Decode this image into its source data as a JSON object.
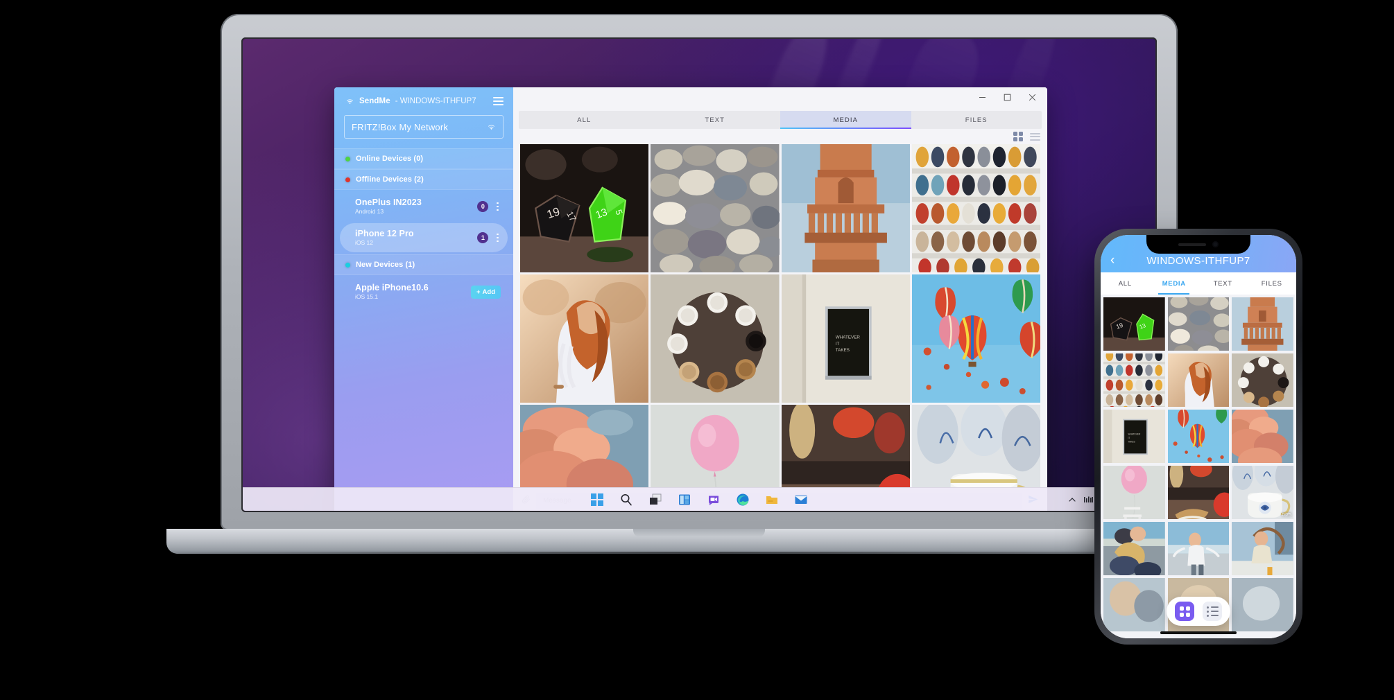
{
  "app": {
    "sidebar": {
      "brand": "SendMe",
      "separator": " - ",
      "hostname": "WINDOWS-ITHFUP7",
      "wifi_icon": "wifi-icon",
      "menu_icon": "hamburger-menu-icon",
      "network_name": "FRITZ!Box My Network",
      "network_icon": "wifi-icon",
      "groups": [
        {
          "label": "Online Devices (0)",
          "status": "online",
          "color": "#4fd441"
        },
        {
          "label": "Offline Devices (2)",
          "status": "offline",
          "color": "#e0342b"
        },
        {
          "label": "New Devices (1)",
          "status": "new",
          "color": "#19cfe0"
        }
      ],
      "offline_devices": [
        {
          "name": "OnePlus IN2023",
          "os": "Android 13",
          "badge": "0",
          "selected": false
        },
        {
          "name": "iPhone 12 Pro",
          "os": "iOS 12",
          "badge": "1",
          "selected": true
        }
      ],
      "new_devices": [
        {
          "name": "Apple iPhone10.6",
          "os": "iOS 15.1",
          "add_label": "Add",
          "add_icon": "plus-icon"
        }
      ]
    },
    "window_controls": {
      "minimize": "minimize-icon",
      "maximize": "maximize-icon",
      "close": "close-icon"
    },
    "tabs": [
      {
        "label": "ALL",
        "active": false
      },
      {
        "label": "TEXT",
        "active": false
      },
      {
        "label": "MEDIA",
        "active": true
      },
      {
        "label": "FILES",
        "active": false
      }
    ],
    "view_toggle": {
      "grid": "grid-view-icon",
      "list": "list-view-icon",
      "active": "grid"
    },
    "composer": {
      "attach_icon": "paperclip-icon",
      "placeholder": "Message",
      "value": "",
      "send_icon": "send-icon"
    },
    "gallery": [
      {
        "id": "dice",
        "alt": "two polyhedral dice black and green"
      },
      {
        "id": "pebbles",
        "alt": "smooth grey pebbles"
      },
      {
        "id": "tower",
        "alt": "red sandstone minaret tower"
      },
      {
        "id": "shoes",
        "alt": "colorful shoes on shelves"
      },
      {
        "id": "woman",
        "alt": "woman with red hair at sunset"
      },
      {
        "id": "coffee",
        "alt": "coffee cups arranged in circle on wood"
      },
      {
        "id": "poster",
        "alt": "framed black poster on wall"
      },
      {
        "id": "balloons",
        "alt": "hot air balloons in blue sky"
      },
      {
        "id": "clouds",
        "alt": "orange pink smoke clouds"
      },
      {
        "id": "balloon",
        "alt": "pink balloon with chair"
      },
      {
        "id": "cafe",
        "alt": "blurred cafe with sandwich"
      },
      {
        "id": "teacup",
        "alt": "blue patterned porcelain teacup"
      }
    ]
  },
  "phone": {
    "status": {
      "speaker": "speaker-grille",
      "camera": "front-camera"
    },
    "header": {
      "back_icon": "back-chevron-icon",
      "title": "WINDOWS-ITHFUP7"
    },
    "tabs": [
      {
        "label": "ALL",
        "active": false
      },
      {
        "label": "MEDIA",
        "active": true
      },
      {
        "label": "TEXT",
        "active": false
      },
      {
        "label": "FILES",
        "active": false
      }
    ],
    "view_toggle": {
      "grid": "grid-view-icon",
      "list": "list-view-icon",
      "active": "grid"
    },
    "gallery": [
      {
        "id": "dice"
      },
      {
        "id": "pebbles"
      },
      {
        "id": "tower"
      },
      {
        "id": "shoes"
      },
      {
        "id": "woman"
      },
      {
        "id": "coffee"
      },
      {
        "id": "poster"
      },
      {
        "id": "balloons"
      },
      {
        "id": "clouds"
      },
      {
        "id": "balloon"
      },
      {
        "id": "cafe"
      },
      {
        "id": "teacup"
      },
      {
        "id": "hug"
      },
      {
        "id": "beach"
      },
      {
        "id": "city"
      },
      {
        "id": "extra1"
      },
      {
        "id": "extra2"
      },
      {
        "id": "extra3"
      }
    ],
    "media_badge": "0:25"
  },
  "taskbar": {
    "items": [
      {
        "name": "start-button",
        "icon": "windows-logo-icon"
      },
      {
        "name": "search-button",
        "icon": "search-icon"
      },
      {
        "name": "task-view-button",
        "icon": "task-view-icon"
      },
      {
        "name": "widgets-button",
        "icon": "widgets-icon"
      },
      {
        "name": "chat-button",
        "icon": "chat-icon"
      },
      {
        "name": "edge-button",
        "icon": "edge-browser-icon"
      },
      {
        "name": "file-explorer-button",
        "icon": "folder-icon"
      },
      {
        "name": "mail-button",
        "icon": "mail-icon"
      }
    ],
    "tray": [
      {
        "name": "show-hidden-icons",
        "icon": "chevron-up-icon"
      },
      {
        "name": "network-signal",
        "icon": "signal-icon"
      },
      {
        "name": "wifi-status",
        "icon": "wifi-icon"
      },
      {
        "name": "volume",
        "icon": "speaker-icon"
      },
      {
        "name": "battery",
        "icon": "battery-icon"
      }
    ]
  },
  "colors": {
    "sidebar_start": "#7fc1f9",
    "sidebar_end": "#a99bf2",
    "accent_purple": "#7c4dff",
    "accent_blue": "#4fc3f7",
    "badge": "#51318f",
    "send_blue": "#2f7ff0",
    "phone_accent": "#3aa7f0",
    "fab_active": "#7a5cf0"
  }
}
